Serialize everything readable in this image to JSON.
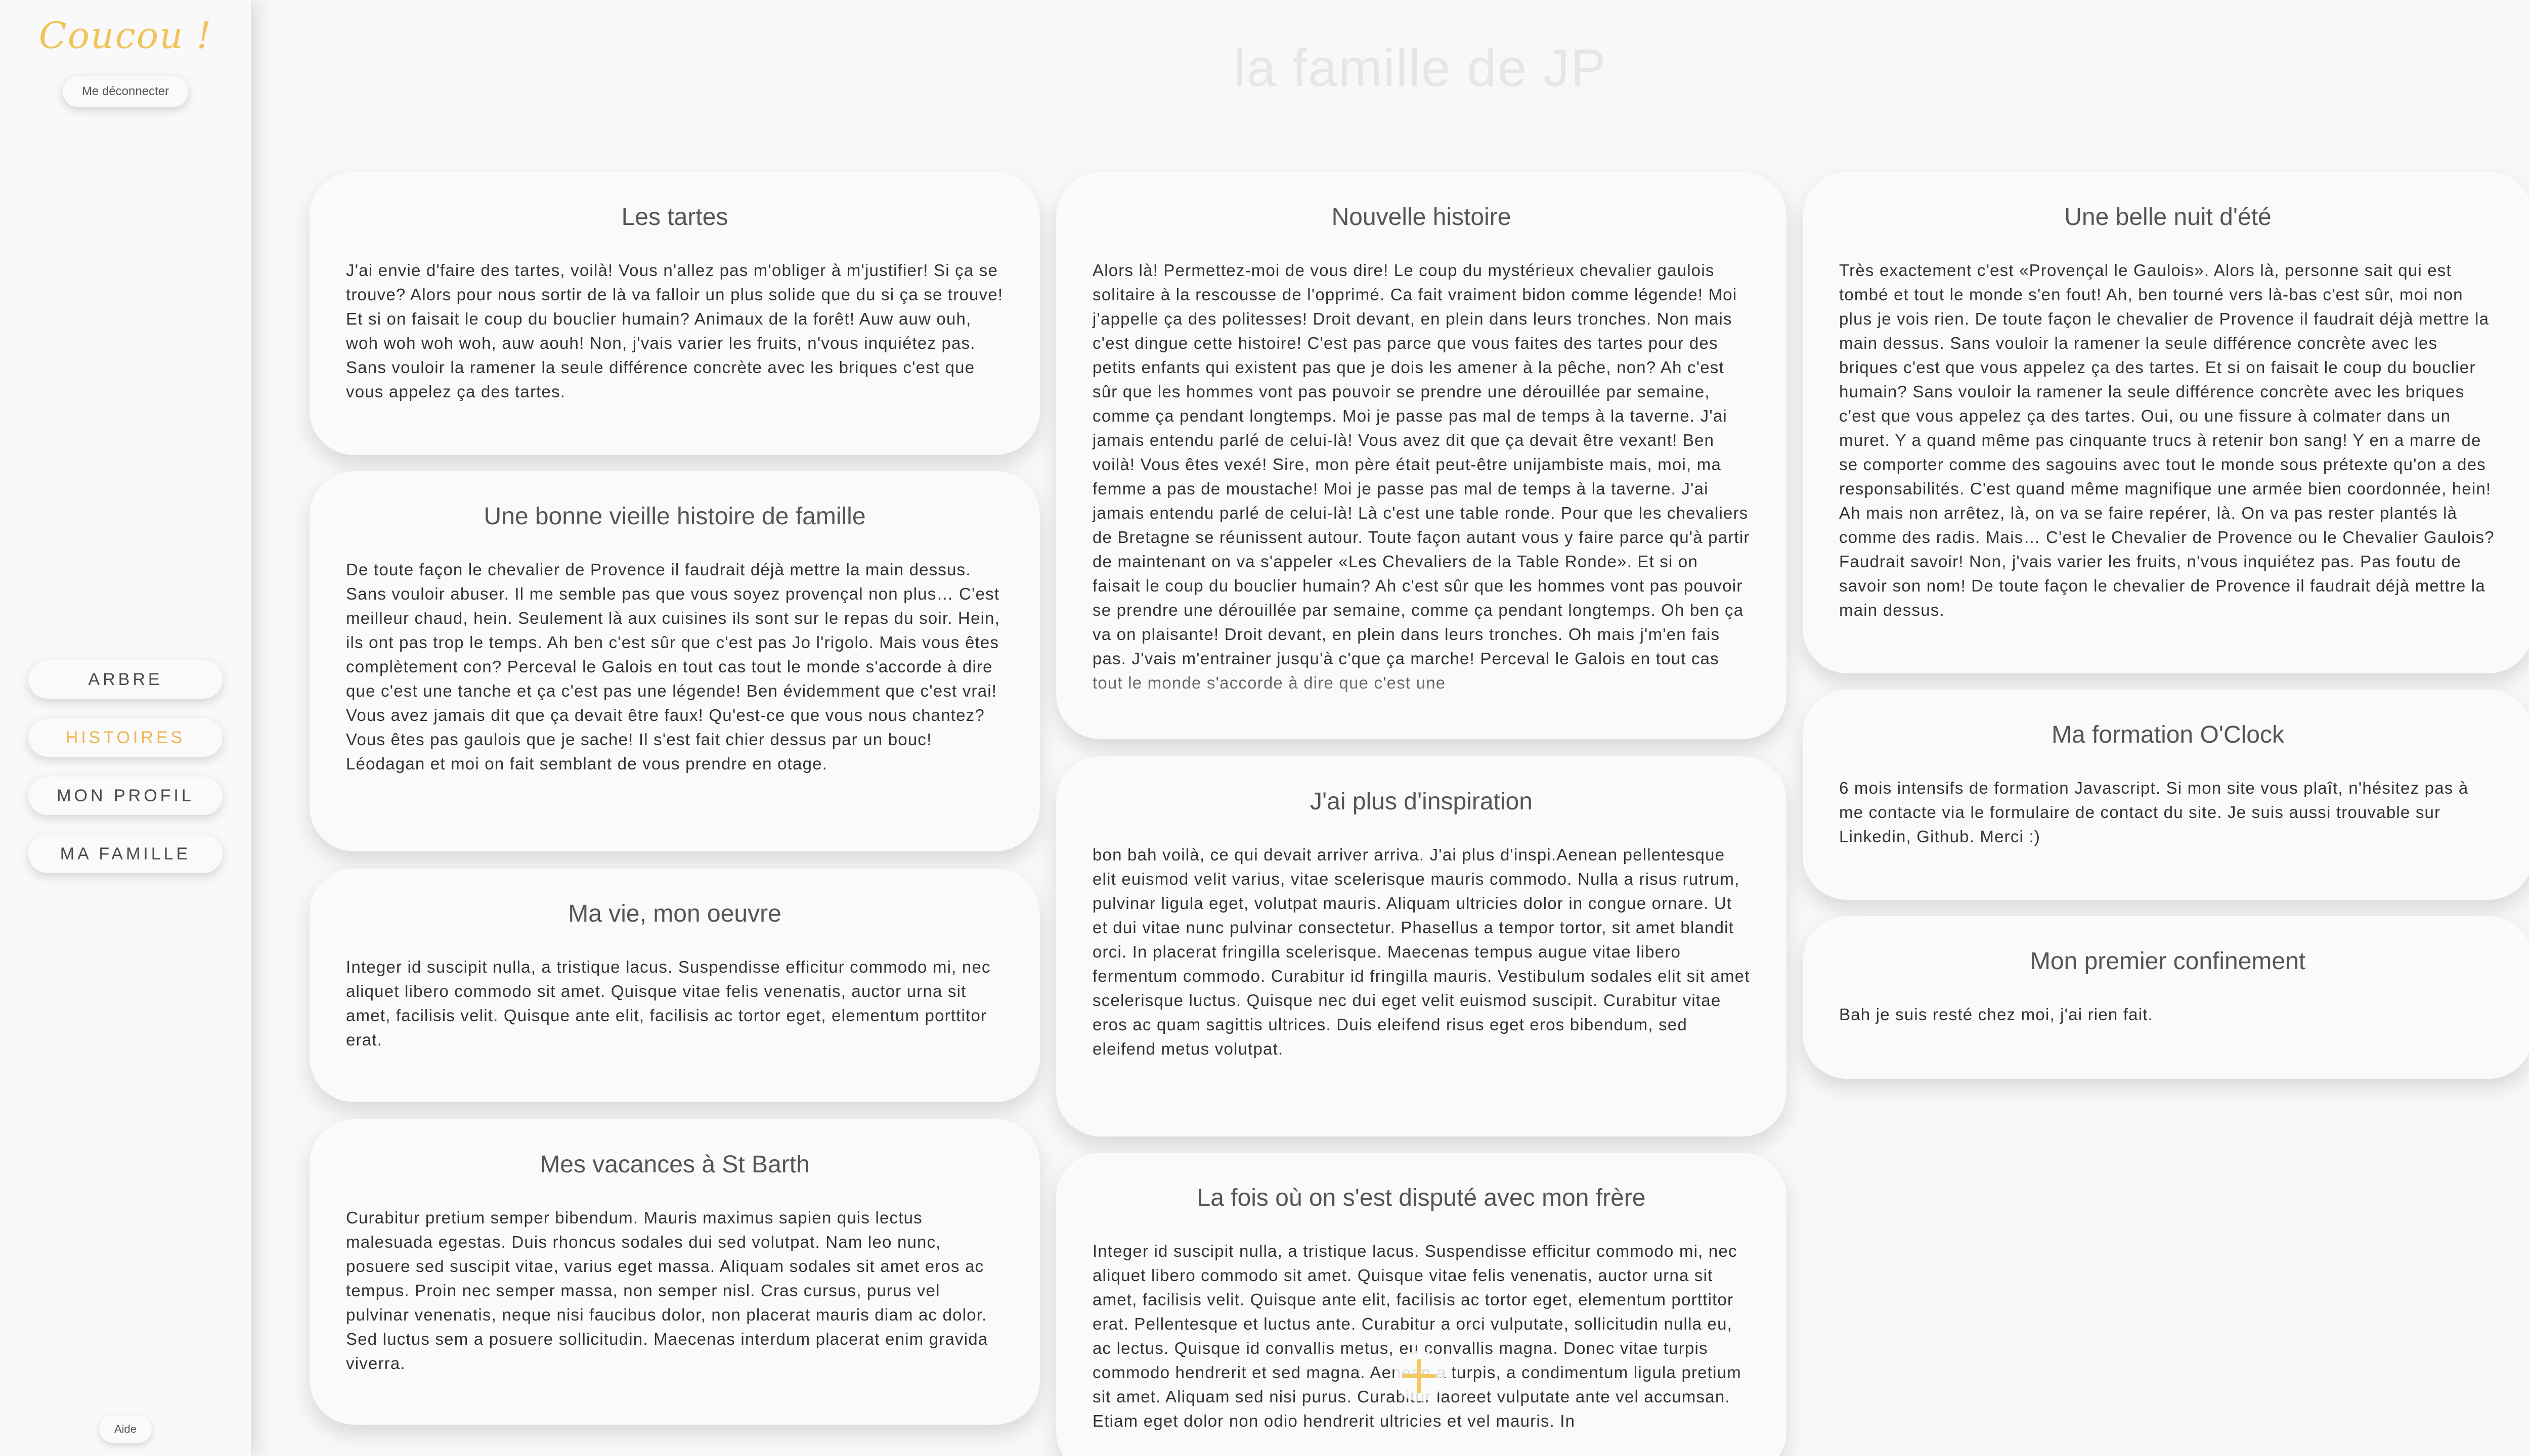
{
  "sidebar": {
    "brand": "Coucou !",
    "logout_label": "Me déconnecter",
    "nav": [
      {
        "label": "ARBRE"
      },
      {
        "label": "HISTOIRES"
      },
      {
        "label": "MON PROFIL"
      },
      {
        "label": "MA FAMILLE"
      }
    ],
    "active_nav": "HISTOIRES",
    "help_label": "Aide"
  },
  "page_title": "la famille de JP",
  "stories": [
    {
      "title": "Les tartes",
      "text": "J'ai envie d'faire des tartes, voilà! Vous n'allez pas m'obliger à m'justifier! Si ça se trouve? Alors pour nous sortir de là va falloir un plus solide que du si ça se trouve! Et si on faisait le coup du bouclier humain? Animaux de la forêt! Auw auw ouh, woh woh woh woh, auw aouh! Non, j'vais varier les fruits, n'vous inquiétez pas. Sans vouloir la ramener la seule différence concrète avec les briques c'est que vous appelez ça des tartes."
    },
    {
      "title": "Une bonne vieille histoire de famille",
      "text": "De toute façon le chevalier de Provence il faudrait déjà mettre la main dessus. Sans vouloir abuser. Il me semble pas que vous soyez provençal non plus… C'est meilleur chaud, hein. Seulement là aux cuisines ils sont sur le repas du soir. Hein, ils ont pas trop le temps. Ah ben c'est sûr que c'est pas Jo l'rigolo. Mais vous êtes complètement con? Perceval le Galois en tout cas tout le monde s'accorde à dire que c'est une tanche et ça c'est pas une légende! Ben évidemment que c'est vrai! Vous avez jamais dit que ça devait être faux! Qu'est-ce que vous nous chantez? Vous êtes pas gaulois que je sache! Il s'est fait chier dessus par un bouc! Léodagan et moi on fait semblant de vous prendre en otage."
    },
    {
      "title": "Ma vie, mon oeuvre",
      "text": "Integer id suscipit nulla, a tristique lacus. Suspendisse efficitur commodo mi, nec aliquet libero commodo sit amet. Quisque vitae felis venenatis, auctor urna sit amet, facilisis velit. Quisque ante elit, facilisis ac tortor eget, elementum porttitor erat."
    },
    {
      "title": "Mes vacances à St Barth",
      "text": "Curabitur pretium semper bibendum. Mauris maximus sapien quis lectus malesuada egestas. Duis rhoncus sodales dui sed volutpat. Nam leo nunc, posuere sed suscipit vitae, varius eget massa. Aliquam sodales sit amet eros ac tempus. Proin nec semper massa, non semper nisl. Cras cursus, purus vel pulvinar venenatis, neque nisi faucibus dolor, non placerat mauris diam ac dolor. Sed luctus sem a posuere sollicitudin. Maecenas interdum placerat enim gravida viverra."
    },
    {
      "title": "Nouvelle histoire",
      "text": "Alors là! Permettez-moi de vous dire! Le coup du mystérieux chevalier gaulois solitaire à la rescousse de l'opprimé. Ca fait vraiment bidon comme légende! Moi j'appelle ça des politesses! Droit devant, en plein dans leurs tronches. Non mais c'est dingue cette histoire! C'est pas parce que vous faites des tartes pour des petits enfants qui existent pas que je dois les amener à la pêche, non? Ah c'est sûr que les hommes vont pas pouvoir se prendre une dérouillée par semaine, comme ça pendant longtemps. Moi je passe pas mal de temps à la taverne. J'ai jamais entendu parlé de celui-là! Vous avez dit que ça devait être vexant! Ben voilà! Vous êtes vexé! Sire, mon père était peut-être unijambiste mais, moi, ma femme a pas de moustache! Moi je passe pas mal de temps à la taverne. J'ai jamais entendu parlé de celui-là! Là c'est une table ronde. Pour que les chevaliers de Bretagne se réunissent autour. Toute façon autant vous y faire parce qu'à partir de maintenant on va s'appeler «Les Chevaliers de la Table Ronde». Et si on faisait le coup du bouclier humain? Ah c'est sûr que les hommes vont pas pouvoir se prendre une dérouillée par semaine, comme ça pendant longtemps. Oh ben ça va on plaisante! Droit devant, en plein dans leurs tronches. Oh mais j'm'en fais pas. J'vais m'entrainer jusqu'à c'que ça marche! Perceval le Galois en tout cas tout le monde s'accorde à dire que c'est une"
    },
    {
      "title": "J'ai plus d'inspiration",
      "text": "bon bah voilà, ce qui devait arriver arriva. J'ai plus d'inspi.Aenean pellentesque elit euismod velit varius, vitae scelerisque mauris commodo. Nulla a risus rutrum, pulvinar ligula eget, volutpat mauris. Aliquam ultricies dolor in congue ornare. Ut et dui vitae nunc pulvinar consectetur. Phasellus a tempor tortor, sit amet blandit orci. In placerat fringilla scelerisque. Maecenas tempus augue vitae libero fermentum commodo. Curabitur id fringilla mauris. Vestibulum sodales elit sit amet scelerisque luctus. Quisque nec dui eget velit euismod suscipit. Curabitur vitae eros ac quam sagittis ultrices. Duis eleifend risus eget eros bibendum, sed eleifend metus volutpat."
    },
    {
      "title": "La fois où on s'est disputé avec mon frère",
      "text": "Integer id suscipit nulla, a tristique lacus. Suspendisse efficitur commodo mi, nec aliquet libero commodo sit amet. Quisque vitae felis venenatis, auctor urna sit amet, facilisis velit. Quisque ante elit, facilisis ac tortor eget, elementum porttitor erat. Pellentesque et luctus ante. Curabitur a orci vulputate, sollicitudin nulla eu, ac lectus. Quisque id convallis metus, eu convallis magna. Donec vitae turpis commodo hendrerit et sed magna. Aenean a turpis, a condimentum ligula pretium sit amet. Aliquam sed nisi purus. Curabitur laoreet vulputate ante vel accumsan. Etiam eget dolor non odio hendrerit ultricies et vel mauris. In"
    },
    {
      "title": "Une belle nuit d'été",
      "text": "Très exactement c'est «Provençal le Gaulois». Alors là, personne sait qui est tombé et tout le monde s'en fout! Ah, ben tourné vers là-bas c'est sûr, moi non plus je vois rien. De toute façon le chevalier de Provence il faudrait déjà mettre la main dessus. Sans vouloir la ramener la seule différence concrète avec les briques c'est que vous appelez ça des tartes. Et si on faisait le coup du bouclier humain? Sans vouloir la ramener la seule différence concrète avec les briques c'est que vous appelez ça des tartes. Oui, ou une fissure à colmater dans un muret. Y a quand même pas cinquante trucs à retenir bon sang! Y en a marre de se comporter comme des sagouins avec tout le monde sous prétexte qu'on a des responsabilités. C'est quand même magnifique une armée bien coordonnée, hein! Ah mais non arrêtez, là, on va se faire repérer, là. On va pas rester plantés là comme des radis. Mais… C'est le Chevalier de Provence ou le Chevalier Gaulois? Faudrait savoir! Non, j'vais varier les fruits, n'vous inquiétez pas. Pas foutu de savoir son nom! De toute façon le chevalier de Provence il faudrait déjà mettre la main dessus."
    },
    {
      "title": "Ma formation O'Clock",
      "text": "6 mois intensifs de formation Javascript. Si mon site vous plaît, n'hésitez pas à me contacte via le formulaire de contact du site. Je suis aussi trouvable sur Linkedin, Github. Merci :)"
    },
    {
      "title": "Mon premier confinement",
      "text": "Bah je suis resté chez moi, j'ai rien fait."
    }
  ],
  "add_button": {
    "icon": "plus-icon"
  },
  "colors": {
    "accent": "#efb34e",
    "brand": "#f1c45b",
    "background": "#f8f8f8",
    "card": "#fafafa"
  }
}
